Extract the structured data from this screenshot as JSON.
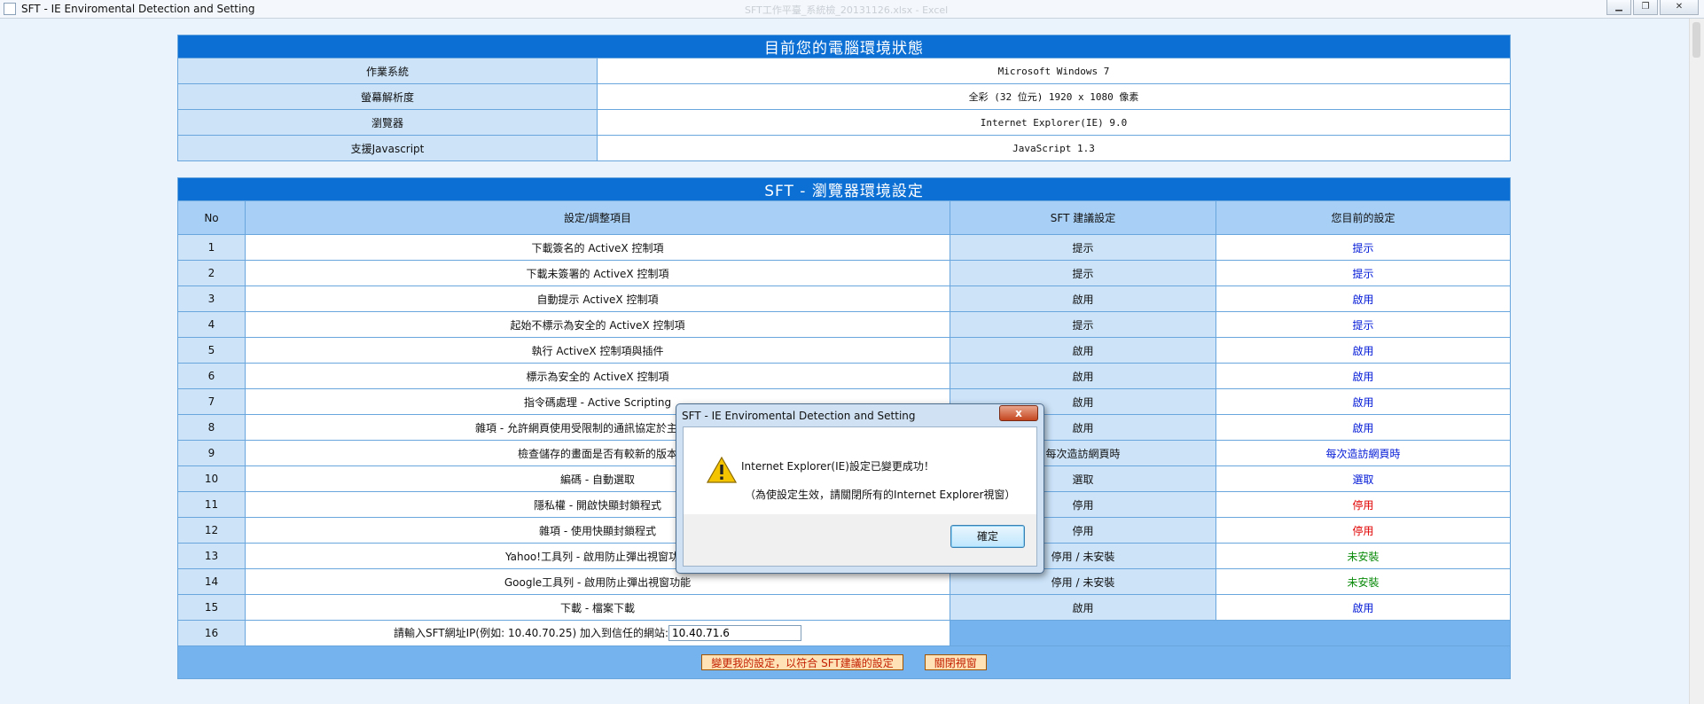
{
  "window": {
    "title": "SFT - IE Enviromental Detection and Setting",
    "ghost_title": "SFT工作平臺_系統檢_20131126.xlsx - Excel"
  },
  "env": {
    "heading": "目前您的電腦環境狀態",
    "rows": [
      {
        "label": "作業系統",
        "value": "Microsoft Windows 7"
      },
      {
        "label": "螢幕解析度",
        "value": "全彩 (32 位元) 1920 x 1080 像素"
      },
      {
        "label": "瀏覽器",
        "value": "Internet Explorer(IE) 9.0"
      },
      {
        "label": "支援Javascript",
        "value": "JavaScript 1.3"
      }
    ]
  },
  "settings": {
    "heading": "SFT - 瀏覽器環境設定",
    "columns": {
      "no": "No",
      "item": "設定/調整項目",
      "suggested": "SFT 建議設定",
      "current": "您目前的設定"
    },
    "rows": [
      {
        "no": "1",
        "item": "下載簽名的 ActiveX 控制項",
        "suggested": "提示",
        "current": "提示",
        "status": "blue"
      },
      {
        "no": "2",
        "item": "下載未簽署的 ActiveX 控制項",
        "suggested": "提示",
        "current": "提示",
        "status": "blue"
      },
      {
        "no": "3",
        "item": "自動提示 ActiveX 控制項",
        "suggested": "啟用",
        "current": "啟用",
        "status": "blue"
      },
      {
        "no": "4",
        "item": "起始不標示為安全的 ActiveX 控制項",
        "suggested": "提示",
        "current": "提示",
        "status": "blue"
      },
      {
        "no": "5",
        "item": "執行 ActiveX 控制項與插件",
        "suggested": "啟用",
        "current": "啟用",
        "status": "blue"
      },
      {
        "no": "6",
        "item": "標示為安全的 ActiveX 控制項",
        "suggested": "啟用",
        "current": "啟用",
        "status": "blue"
      },
      {
        "no": "7",
        "item": "指令碼處理 - Active Scripting",
        "suggested": "啟用",
        "current": "啟用",
        "status": "blue"
      },
      {
        "no": "8",
        "item": "雜項 - 允許網頁使用受限制的通訊協定於主動式內容",
        "suggested": "啟用",
        "current": "啟用",
        "status": "blue"
      },
      {
        "no": "9",
        "item": "檢查儲存的畫面是否有較新的版本",
        "suggested": "每次造訪網頁時",
        "current": "每次造訪網頁時",
        "status": "blue"
      },
      {
        "no": "10",
        "item": "編碼 - 自動選取",
        "suggested": "選取",
        "current": "選取",
        "status": "blue"
      },
      {
        "no": "11",
        "item": "隱私權 - 開啟快顯封鎖程式",
        "suggested": "停用",
        "current": "停用",
        "status": "red"
      },
      {
        "no": "12",
        "item": "雜項 - 使用快顯封鎖程式",
        "suggested": "停用",
        "current": "停用",
        "status": "red"
      },
      {
        "no": "13",
        "item": "Yahoo!工具列 - 啟用防止彈出視窗功能",
        "suggested": "停用 / 未安裝",
        "current": "未安裝",
        "status": "green"
      },
      {
        "no": "14",
        "item": "Google工具列 - 啟用防止彈出視窗功能",
        "suggested": "停用 / 未安裝",
        "current": "未安裝",
        "status": "green"
      },
      {
        "no": "15",
        "item": "下載 - 檔案下載",
        "suggested": "啟用",
        "current": "啟用",
        "status": "blue"
      }
    ],
    "ip_row": {
      "no": "16",
      "label": "請輸入SFT網址IP(例如: 10.40.70.25) 加入到信任的網站:",
      "value": "10.40.71.6"
    },
    "apply_button": "變更我的設定，以符合 SFT建議的設定",
    "close_button": "關閉視窗"
  },
  "dialog": {
    "title": "SFT - IE Enviromental Detection and Setting",
    "close_label": "x",
    "message": "Internet Explorer(IE)設定已變更成功！",
    "note": "（為使設定生效，請關閉所有的Internet Explorer視窗）",
    "ok_label": "確定"
  },
  "colors": {
    "blue": "#0018d6",
    "red": "#e00000",
    "green": "#0a8a0a",
    "header": "#0b6fd4"
  }
}
